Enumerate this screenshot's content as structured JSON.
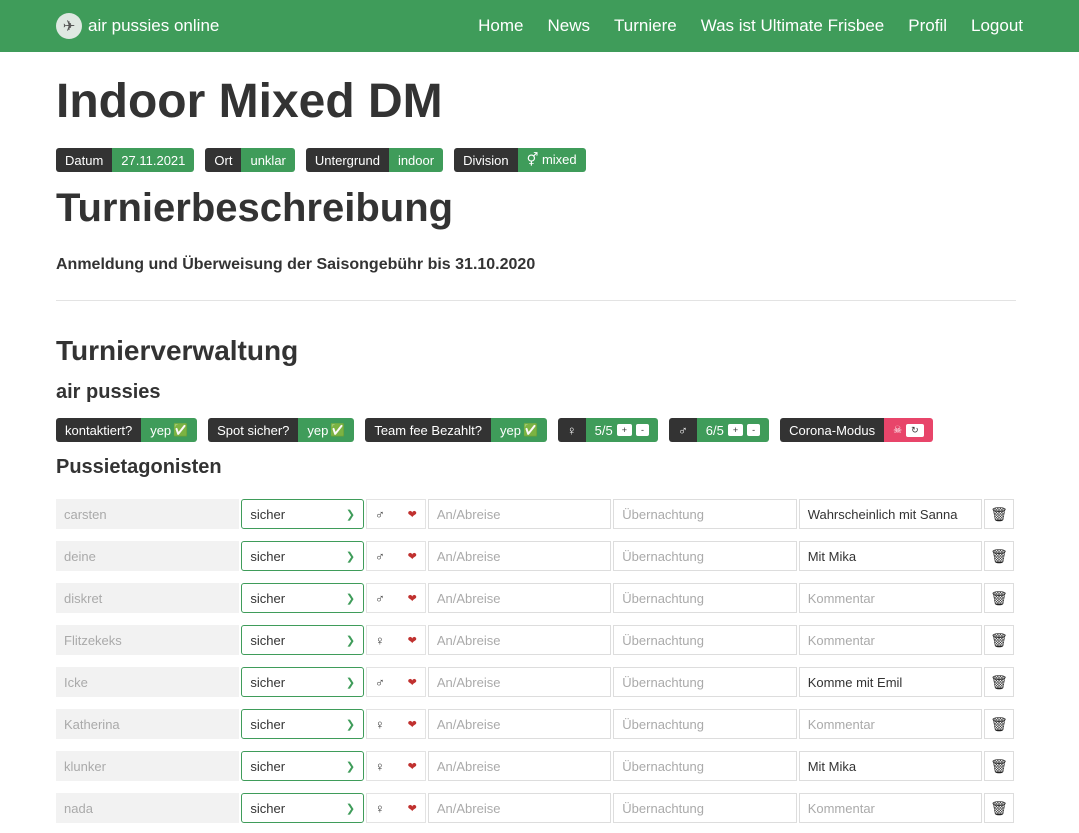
{
  "nav": {
    "brand": "air pussies online",
    "links": [
      "Home",
      "News",
      "Turniere",
      "Was ist Ultimate Frisbee",
      "Profil",
      "Logout"
    ]
  },
  "title": "Indoor Mixed DM",
  "badges": [
    {
      "key": "Datum",
      "value": "27.11.2021"
    },
    {
      "key": "Ort",
      "value": "unklar"
    },
    {
      "key": "Untergrund",
      "value": "indoor"
    },
    {
      "key": "Division",
      "value": "⚥ mixed"
    }
  ],
  "description_heading": "Turnierbeschreibung",
  "description_text": "Anmeldung und Überweisung der Saisongebühr bis 31.10.2020",
  "admin_heading": "Turnierverwaltung",
  "team_name": "air pussies",
  "status": {
    "contacted": {
      "label": "kontaktiert?",
      "value": "yep"
    },
    "spot": {
      "label": "Spot sicher?",
      "value": "yep"
    },
    "fee": {
      "label": "Team fee Bezahlt?",
      "value": "yep"
    },
    "female": {
      "symbol": "♀",
      "count": "5/5",
      "plus": "+",
      "minus": "-"
    },
    "male": {
      "symbol": "♂",
      "count": "6/5",
      "plus": "+",
      "minus": "-"
    },
    "corona": {
      "label": "Corona-Modus",
      "icon": "☠",
      "toggle": "↻"
    }
  },
  "players_heading": "Pussietagonisten",
  "placeholders": {
    "travel": "An/Abreise",
    "stay": "Übernachtung",
    "comment": "Kommentar"
  },
  "players": [
    {
      "name": "carsten",
      "status": "sicher",
      "gender": "♂",
      "comment": "Wahrscheinlich mit Sanna"
    },
    {
      "name": "deine",
      "status": "sicher",
      "gender": "♂",
      "comment": "Mit Mika"
    },
    {
      "name": "diskret",
      "status": "sicher",
      "gender": "♂",
      "comment": ""
    },
    {
      "name": "Flitzekeks",
      "status": "sicher",
      "gender": "♀",
      "comment": ""
    },
    {
      "name": "Icke",
      "status": "sicher",
      "gender": "♂",
      "comment": "Komme mit Emil"
    },
    {
      "name": "Katherina",
      "status": "sicher",
      "gender": "♀",
      "comment": ""
    },
    {
      "name": "klunker",
      "status": "sicher",
      "gender": "♀",
      "comment": "Mit Mika"
    },
    {
      "name": "nada",
      "status": "sicher",
      "gender": "♀",
      "comment": ""
    }
  ],
  "colors": {
    "primary": "#3f9c5a",
    "dark": "#333333",
    "danger": "#e8456a",
    "heart": "#c0312f"
  }
}
